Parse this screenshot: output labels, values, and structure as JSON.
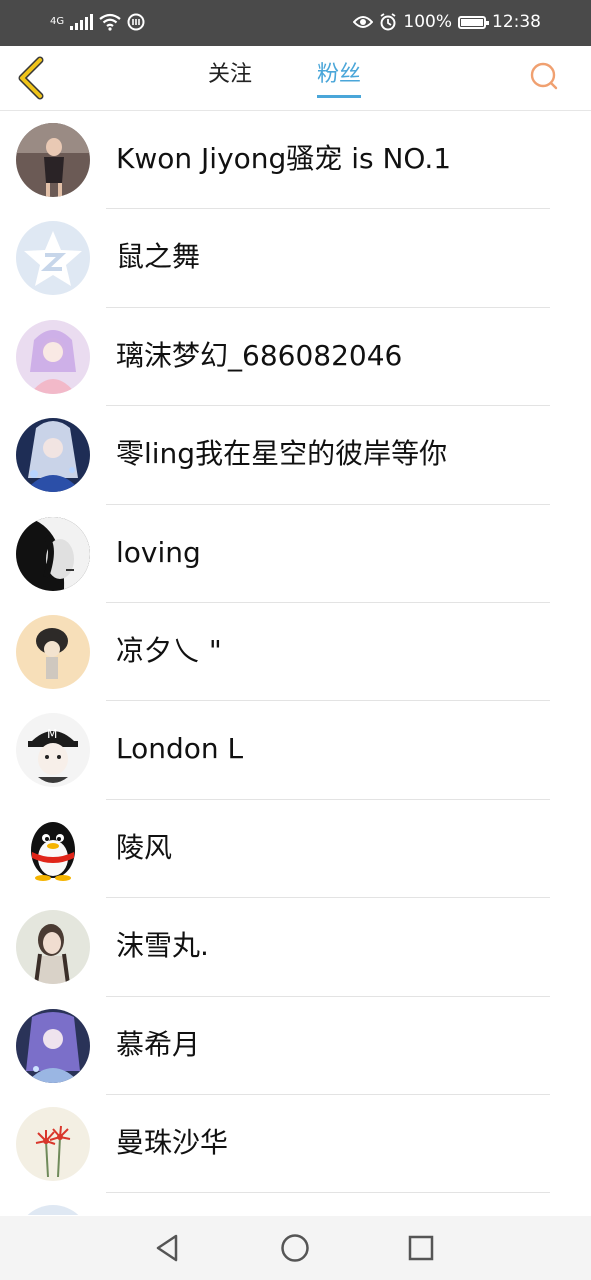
{
  "status_bar": {
    "network": "4G",
    "battery": "100%",
    "time": "12:38"
  },
  "header": {
    "tabs": [
      {
        "label": "关注",
        "active": false
      },
      {
        "label": "粉丝",
        "active": true
      }
    ],
    "accent_color": "#4aa6d9",
    "back_color": "#f0c419",
    "search_color": "#f0a070"
  },
  "fans": [
    {
      "name": "Kwon Jiyong骚宠 is NO.1",
      "avatar": "photo-woman"
    },
    {
      "name": "鼠之舞",
      "avatar": "default-star"
    },
    {
      "name": "璃沫梦幻_686082046",
      "avatar": "anime-pink"
    },
    {
      "name": "零ling我在星空的彼岸等你",
      "avatar": "anime-blue"
    },
    {
      "name": "loving",
      "avatar": "bw-face"
    },
    {
      "name": "凉夕乀 \"",
      "avatar": "sketch-girl"
    },
    {
      "name": "London L",
      "avatar": "cap-boy"
    },
    {
      "name": "陵风",
      "avatar": "penguin"
    },
    {
      "name": "沫雪丸.",
      "avatar": "photo-girl"
    },
    {
      "name": "慕希月",
      "avatar": "anime-purple"
    },
    {
      "name": "曼珠沙华",
      "avatar": "red-flowers"
    }
  ]
}
